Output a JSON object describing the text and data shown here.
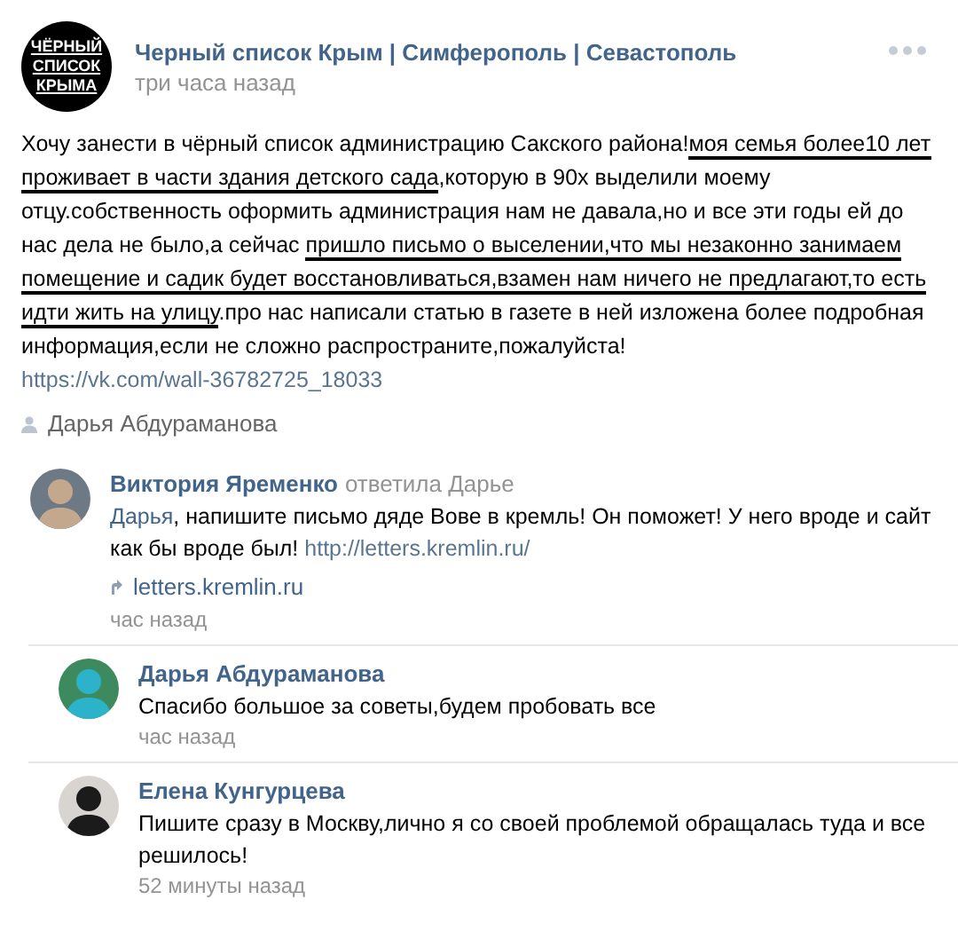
{
  "post": {
    "author": "Черный список Крым | Симферополь | Севастополь",
    "time": "три часа назад",
    "logo_lines": [
      "ЧЁРНЫЙ",
      "СПИСОК",
      "КРЫМА"
    ],
    "text": [
      {
        "text": "Хочу занести в чёрный список администрацию Сакского района!",
        "underlined": false
      },
      {
        "text": "моя семья более10 лет проживает в части здания детского сада",
        "underlined": true
      },
      {
        "text": ",которую в 90х выделили моему отцу.собственность оформить администрация нам не давала,но и все эти годы ей до нас дела не было,а сейчас ",
        "underlined": false
      },
      {
        "text": "пришло письмо о выселении,что мы незаконно занимаем помещение и садик будет восстановливаться,взамен нам ничего не предлагают,то есть идти жить на улицу",
        "underlined": true
      },
      {
        "text": ".про нас написали статью в газете в ней изложена более подробная информация,если не сложно распространите,пожалуйста! ",
        "underlined": false
      },
      {
        "text": "https://vk.com/wall-36782725_18033",
        "kind": "link"
      }
    ],
    "signed_by": "Дарья Абдураманова"
  },
  "comments": [
    {
      "name": "Виктория Яременко",
      "reply_to": "ответила Дарье",
      "body": [
        {
          "kind": "mention",
          "text": "Дарья"
        },
        {
          "kind": "text",
          "text": ", напишите письмо дяде Вове в кремль! Он поможет! У него вроде и сайт как бы вроде был! "
        },
        {
          "kind": "link",
          "text": "http://letters.kremlin.ru/"
        }
      ],
      "attachment": "letters.kremlin.ru",
      "time": "час назад"
    },
    {
      "name": "Дарья Абдураманова",
      "body": [
        {
          "kind": "text",
          "text": "Спасибо большое за советы,будем пробовать все"
        }
      ],
      "time": "час назад"
    },
    {
      "name": "Елена Кунгурцева",
      "body": [
        {
          "kind": "text",
          "text": "Пишите сразу в Москву,лично я со своей проблемой обращалась туда и все решилось!"
        }
      ],
      "time": "52 минуты назад"
    }
  ]
}
